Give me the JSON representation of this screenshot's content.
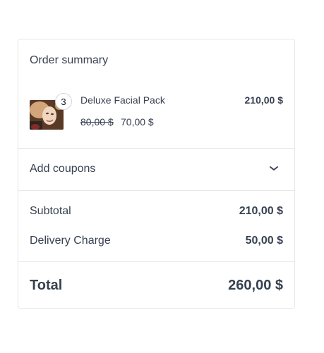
{
  "summary": {
    "title": "Order summary",
    "item": {
      "quantity": "3",
      "name": "Deluxe Facial Pack",
      "line_total": "210,00 $",
      "original_price": "80,00 $",
      "sale_price": "70,00 $",
      "image_icon": "product-photo"
    },
    "coupons": {
      "label": "Add coupons",
      "icon": "chevron-down-icon"
    },
    "subtotal": {
      "label": "Subtotal",
      "value": "210,00 $"
    },
    "delivery": {
      "label": "Delivery Charge",
      "value": "50,00 $"
    },
    "total": {
      "label": "Total",
      "value": "260,00 $"
    }
  },
  "colors": {
    "text": "#374151",
    "border": "#e5e7eb"
  }
}
